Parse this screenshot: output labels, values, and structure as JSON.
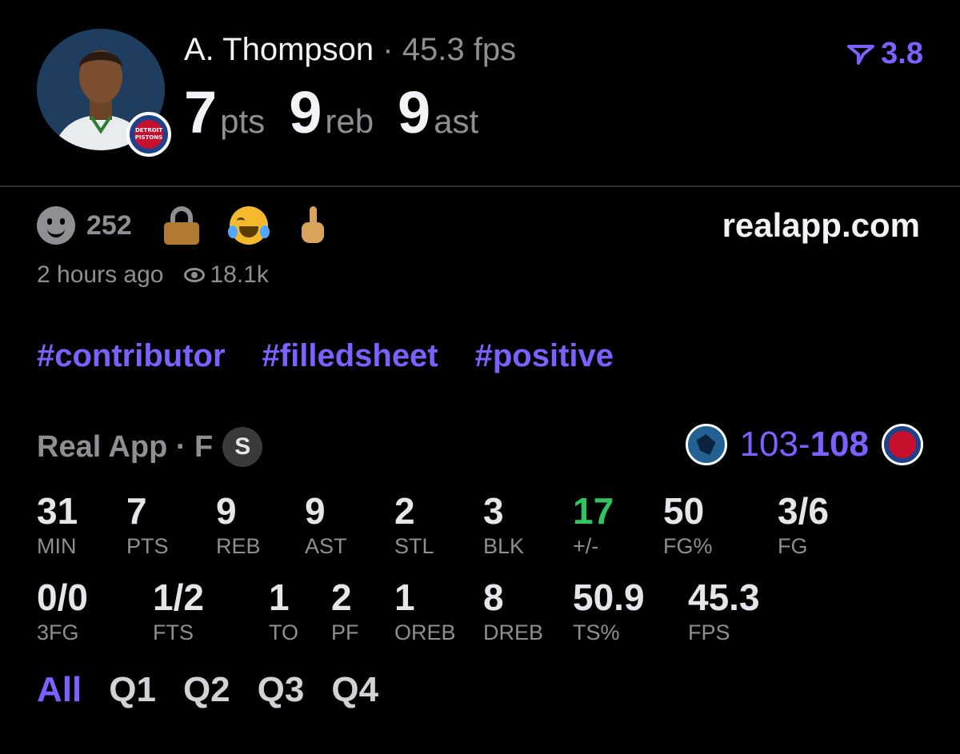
{
  "player": {
    "name": "A. Thompson",
    "separator": "·",
    "fps_summary": "45.3 fps",
    "team_badge": "DETROIT PISTONS",
    "pts": "7",
    "pts_unit": "pts",
    "reb": "9",
    "reb_unit": "reb",
    "ast": "9",
    "ast_unit": "ast"
  },
  "rating": {
    "value": "3.8",
    "icon": "rating-flag-icon",
    "color": "#7b61ff"
  },
  "reactions": {
    "count": "252",
    "icons": [
      "smile-icon",
      "lock-icon",
      "laugh-icon",
      "hand-icon"
    ]
  },
  "site": "realapp.com",
  "meta": {
    "time_ago": "2 hours ago",
    "views": "18.1k"
  },
  "tags": [
    "#contributor",
    "#filledsheet",
    "#positive"
  ],
  "game": {
    "source": "Real App · F",
    "badge": "S",
    "away_score": "103",
    "dash": "-",
    "home_score": "108"
  },
  "stats_row1": [
    {
      "value": "31",
      "label": "MIN"
    },
    {
      "value": "7",
      "label": "PTS"
    },
    {
      "value": "9",
      "label": "REB"
    },
    {
      "value": "9",
      "label": "AST"
    },
    {
      "value": "2",
      "label": "STL"
    },
    {
      "value": "3",
      "label": "BLK"
    },
    {
      "value": "17",
      "label": "+/-"
    },
    {
      "value": "50",
      "label": "FG%"
    },
    {
      "value": "3/6",
      "label": "FG"
    }
  ],
  "stats_row2": [
    {
      "value": "0/0",
      "label": "3FG"
    },
    {
      "value": "1/2",
      "label": "FTS"
    },
    {
      "value": "1",
      "label": "TO"
    },
    {
      "value": "2",
      "label": "PF"
    },
    {
      "value": "1",
      "label": "OREB"
    },
    {
      "value": "8",
      "label": "DREB"
    },
    {
      "value": "50.9",
      "label": "TS%"
    },
    {
      "value": "45.3",
      "label": "FPS"
    }
  ],
  "periods": [
    "All",
    "Q1",
    "Q2",
    "Q3",
    "Q4"
  ],
  "colors": {
    "accent": "#7b61ff",
    "positive": "#2fc561",
    "muted": "#8e8e93",
    "background": "#000000"
  }
}
